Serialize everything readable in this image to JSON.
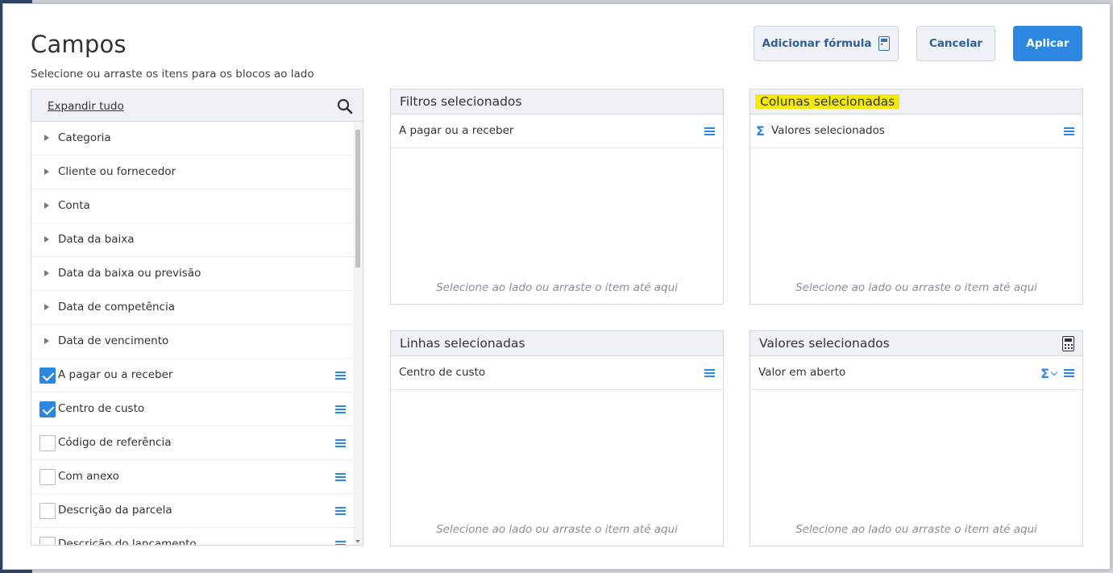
{
  "modal": {
    "title": "Campos",
    "subtitle": "Selecione ou arraste os itens para os blocos ao lado",
    "buttons": {
      "add_formula": "Adicionar fórmula",
      "cancel": "Cancelar",
      "apply": "Aplicar"
    }
  },
  "fields": {
    "expand_all": "Expandir tudo",
    "groups": [
      {
        "label": "Categoria"
      },
      {
        "label": "Cliente ou fornecedor"
      },
      {
        "label": "Conta"
      },
      {
        "label": "Data da baixa"
      },
      {
        "label": "Data da baixa ou previsão"
      },
      {
        "label": "Data de competência"
      },
      {
        "label": "Data de vencimento"
      }
    ],
    "items": [
      {
        "label": "A pagar ou a receber",
        "checked": true
      },
      {
        "label": "Centro de custo",
        "checked": true
      },
      {
        "label": "Código de referência",
        "checked": false
      },
      {
        "label": "Com anexo",
        "checked": false
      },
      {
        "label": "Descrição da parcela",
        "checked": false
      },
      {
        "label": "Descrição do lançamento",
        "checked": false
      }
    ]
  },
  "panels": {
    "filters": {
      "title": "Filtros selecionados",
      "items": [
        "A pagar ou a receber"
      ],
      "hint": "Selecione ao lado ou arraste o item até aqui"
    },
    "columns": {
      "title": "Colunas selecionadas",
      "items": [
        "Valores selecionados"
      ],
      "hint": "Selecione ao lado ou arraste o item até aqui"
    },
    "rows": {
      "title": "Linhas selecionadas",
      "items": [
        "Centro de custo"
      ],
      "hint": "Selecione ao lado ou arraste o item até aqui"
    },
    "values": {
      "title": "Valores selecionados",
      "items": [
        "Valor em aberto"
      ],
      "hint": "Selecione ao lado ou arraste o item até aqui"
    }
  },
  "colors": {
    "accent": "#2b87e0",
    "highlight": "#f5e909"
  }
}
